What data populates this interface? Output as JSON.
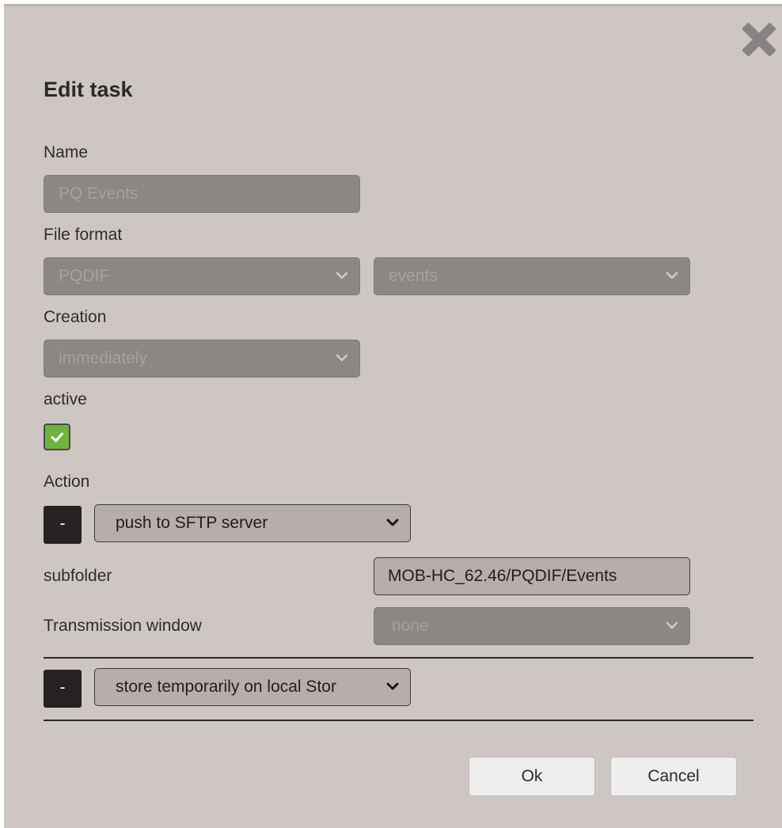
{
  "dialog": {
    "title": "Edit task",
    "close_icon": "close-x-icon"
  },
  "name": {
    "label": "Name",
    "value": "PQ Events"
  },
  "file_format": {
    "label": "File format",
    "format_value": "PQDIF",
    "type_value": "events"
  },
  "creation": {
    "label": "Creation",
    "value": "immediately"
  },
  "active": {
    "label": "active",
    "checked": true
  },
  "action": {
    "label": "Action",
    "items": [
      {
        "remove_label": "-",
        "value": "push to SFTP server",
        "subfolder_label": "subfolder",
        "subfolder_value": "MOB-HC_62.46/PQDIF/Events",
        "window_label": "Transmission window",
        "window_value": "none"
      },
      {
        "remove_label": "-",
        "value": "store temporarily on local Stor"
      }
    ]
  },
  "footer": {
    "ok_label": "Ok",
    "cancel_label": "Cancel"
  },
  "colors": {
    "dialog_bg": "#cec6c3",
    "checkbox_green": "#6fb33e",
    "remove_button": "#262221"
  }
}
